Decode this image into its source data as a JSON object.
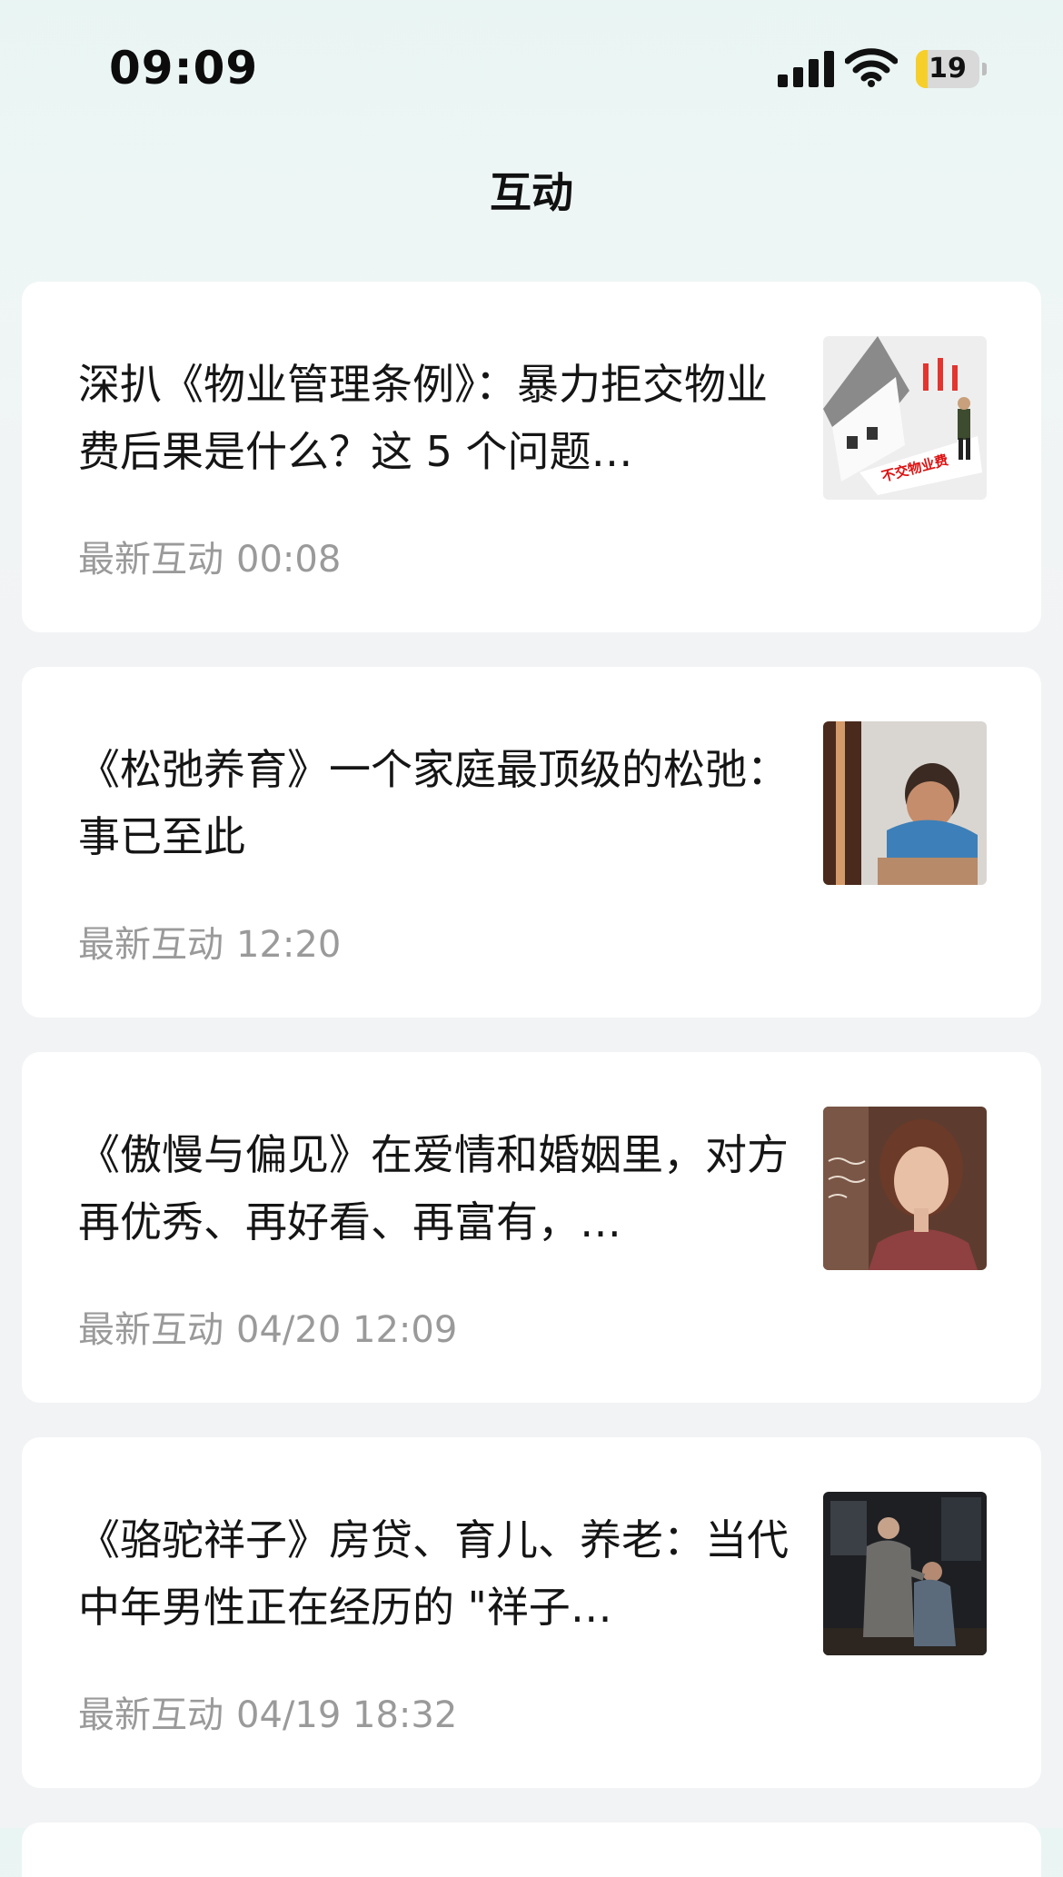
{
  "status_bar": {
    "time": "09:09",
    "battery_level": "19",
    "battery_fraction": 0.19,
    "icons": [
      "cellular-signal-icon",
      "wifi-icon",
      "battery-icon"
    ]
  },
  "nav": {
    "title": "互动"
  },
  "feed": {
    "meta_label": "最新互动",
    "items": [
      {
        "title": "深扒《物业管理条例》：暴力拒交物业费后果是什么？这 5 个问题…",
        "time": "00:08",
        "thumbnail_text": "不交物业费"
      },
      {
        "title": "《松弛养育》一个家庭最顶级的松弛：事已至此",
        "time": "12:20"
      },
      {
        "title": "《傲慢与偏见》在爱情和婚姻里，对方再优秀、再好看、再富有，…",
        "time": "04/20 12:09"
      },
      {
        "title": "《骆驼祥子》房贷、育儿、养老：当代中年男性正在经历的 \"祥子…",
        "time": "04/19 18:32"
      }
    ]
  }
}
